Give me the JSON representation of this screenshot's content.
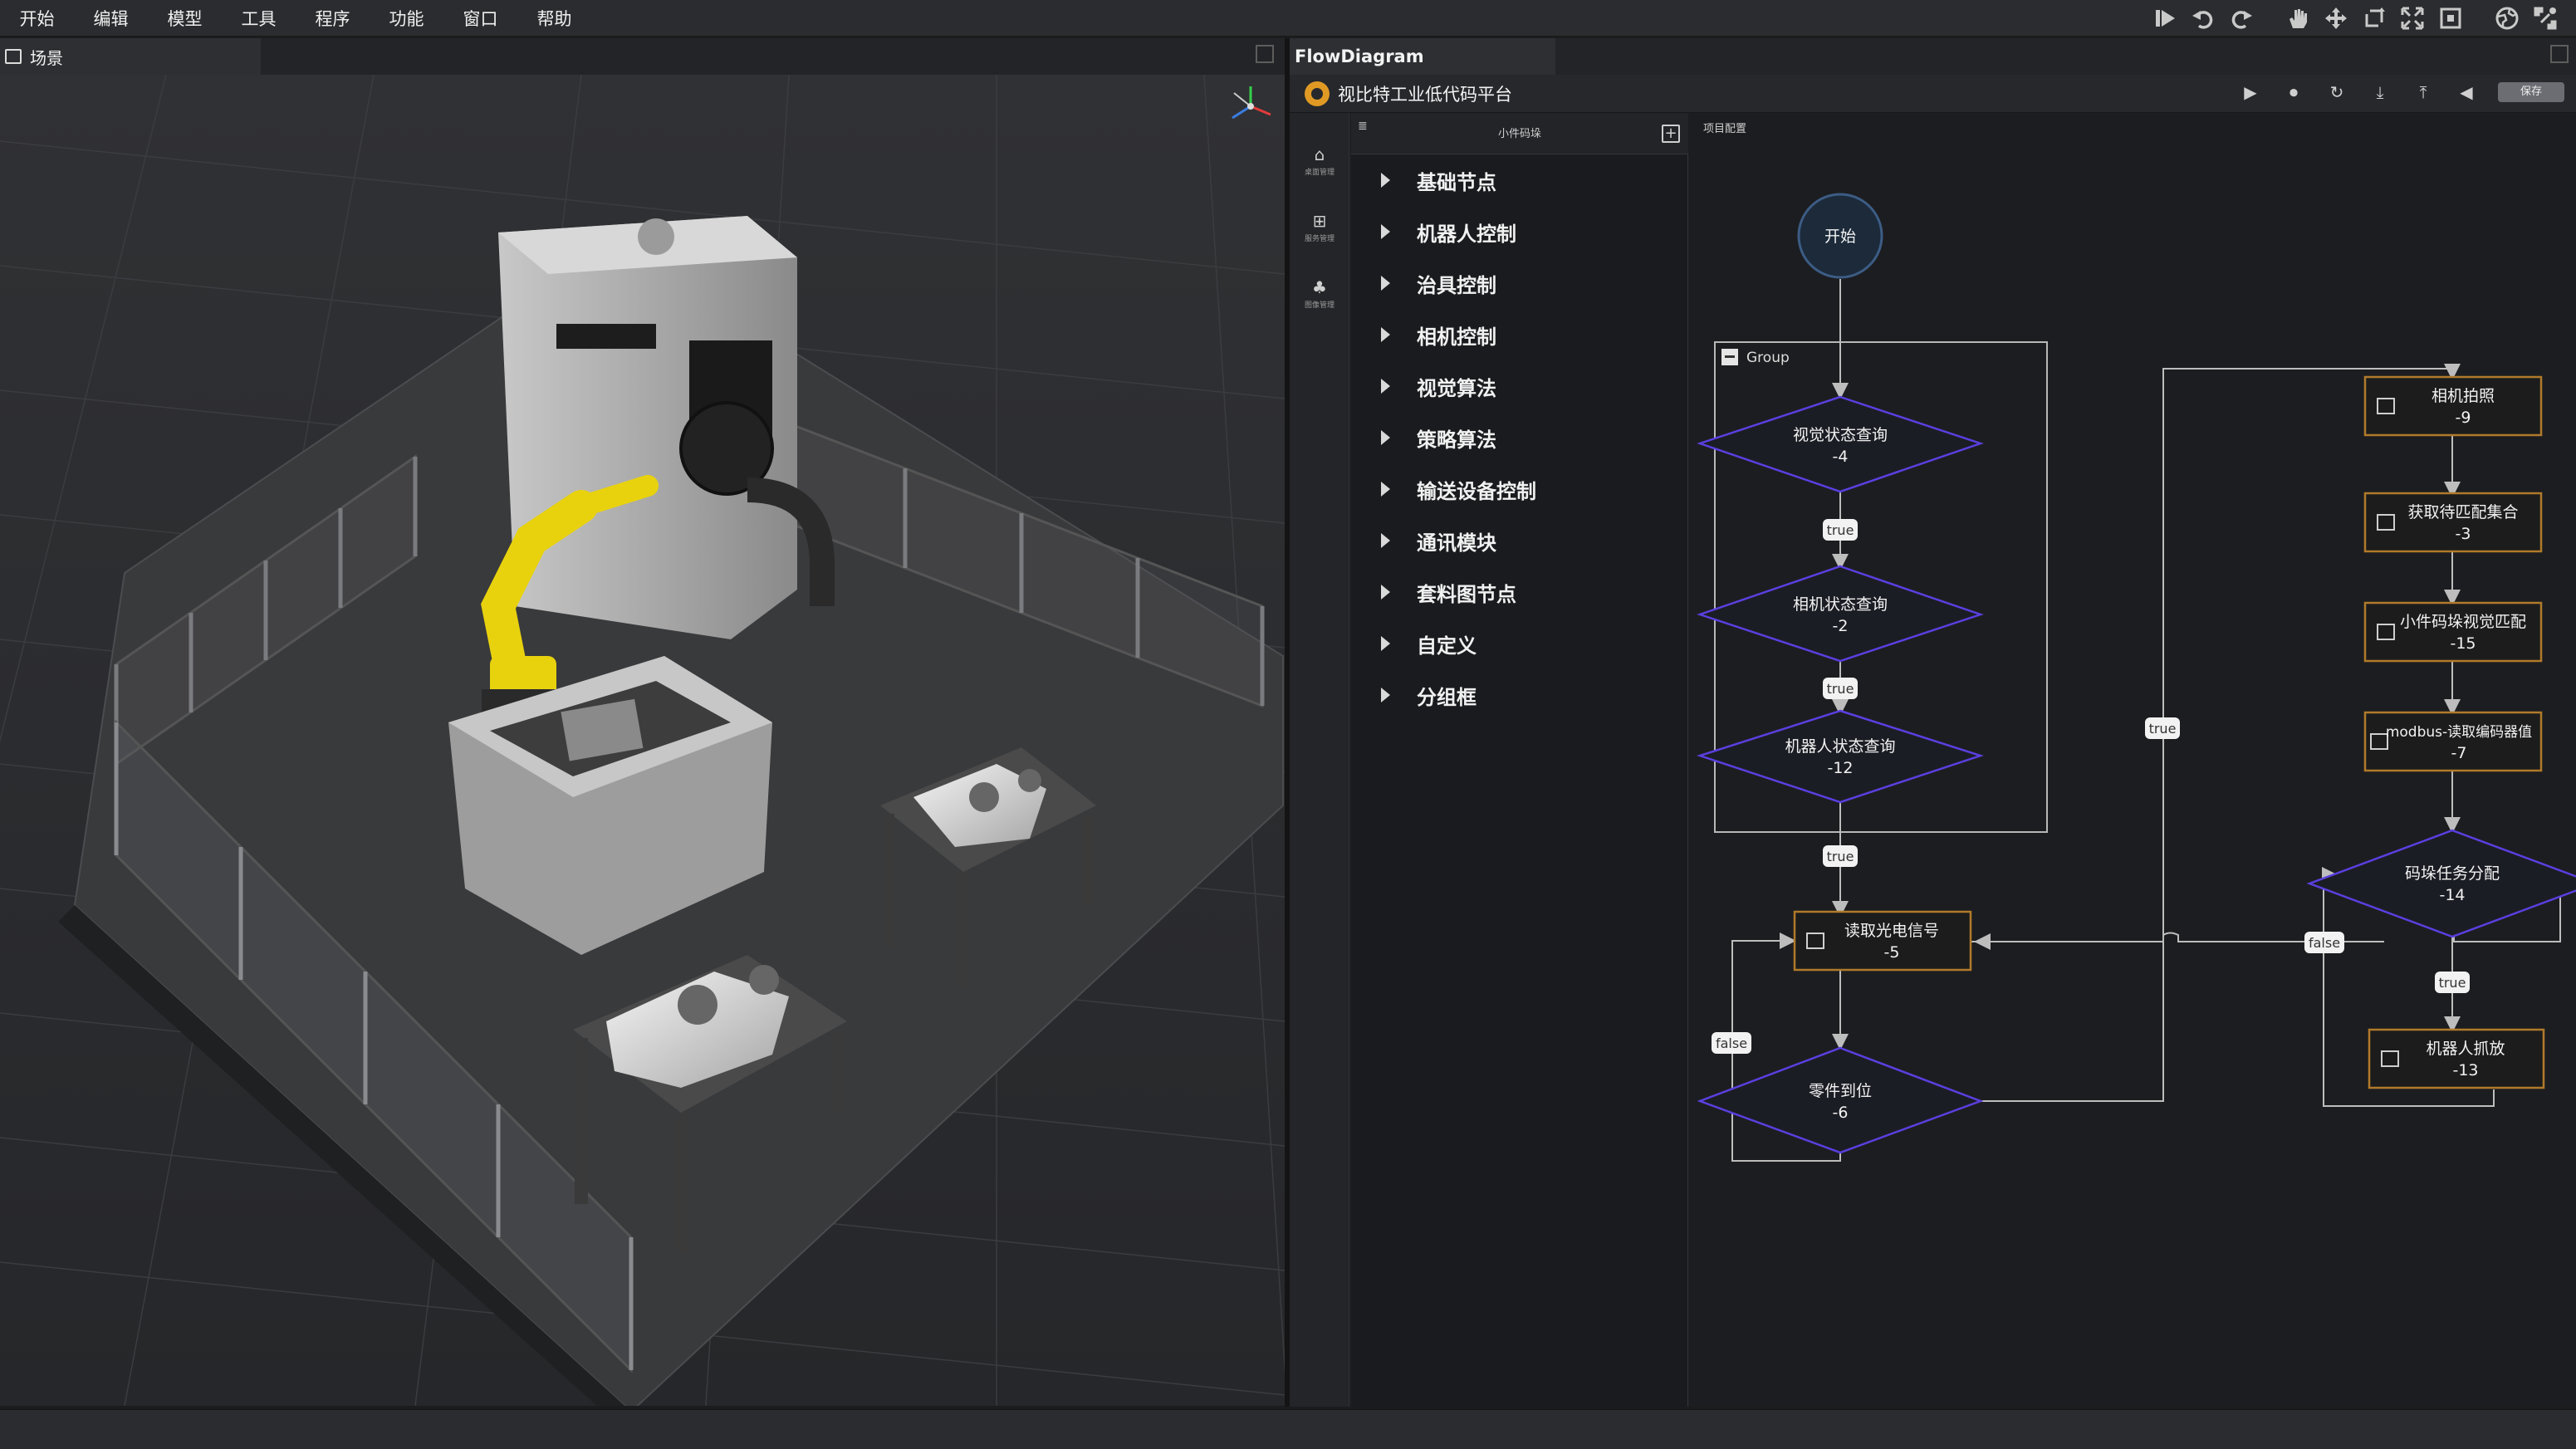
{
  "menu": [
    "开始",
    "编辑",
    "模型",
    "工具",
    "程序",
    "功能",
    "窗口",
    "帮助"
  ],
  "toolbar_icons": [
    "play-step-icon",
    "undo-icon",
    "redo-icon",
    "pan-hand-icon",
    "move-icon",
    "rotate-icon",
    "scale-icon",
    "frame-icon",
    "globe-icon",
    "settings-icon"
  ],
  "scene": {
    "tab_label": "场景"
  },
  "flow": {
    "tab_label": "FlowDiagram",
    "app_title": "视比特工业低代码平台",
    "save_label": "保存",
    "rail": [
      {
        "icon": "home-icon",
        "label": "桌面管理"
      },
      {
        "icon": "grid-icon",
        "label": "服务管理"
      },
      {
        "icon": "hierarchy-icon",
        "label": "图像管理"
      }
    ],
    "module_title": "小件码垛",
    "categories": [
      "基础节点",
      "机器人控制",
      "治具控制",
      "相机控制",
      "视觉算法",
      "策略算法",
      "输送设备控制",
      "通讯模块",
      "套料图节点",
      "自定义",
      "分组框"
    ],
    "canvas_title": "项目配置",
    "group_label": "Group",
    "nodes": {
      "start": "开始",
      "vision_status": [
        "视觉状态查询",
        "-4"
      ],
      "camera_status": [
        "相机状态查询",
        "-2"
      ],
      "robot_status": [
        "机器人状态查询",
        "-12"
      ],
      "read_sensor": [
        "读取光电信号",
        "-5"
      ],
      "part_arrive": [
        "零件到位",
        "-6"
      ],
      "camera_shoot": [
        "相机拍照",
        "-9"
      ],
      "get_match": [
        "获取待匹配集合",
        "-3"
      ],
      "stack_match": [
        "小件码垛视觉匹配",
        "-15"
      ],
      "modbus": [
        "modbus-读取编码器值",
        "-7"
      ],
      "task_assign": [
        "码垛任务分配",
        "-14"
      ],
      "robot_pick": [
        "机器人抓放",
        "-13"
      ]
    },
    "edge_labels": {
      "true": "true",
      "false": "false"
    }
  }
}
